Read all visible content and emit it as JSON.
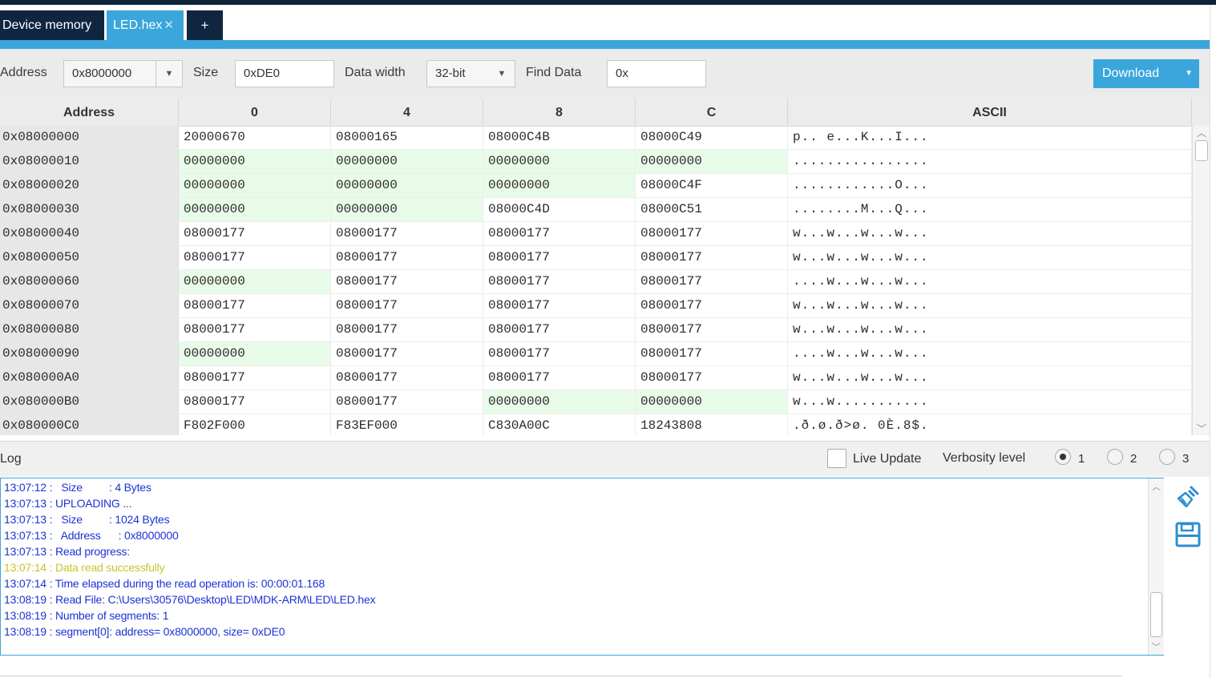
{
  "tabs": [
    {
      "label": "Device memory"
    },
    {
      "label": "LED.hex",
      "close": "✕"
    },
    {
      "label": "+"
    }
  ],
  "toolbar": {
    "address_label": "Address",
    "address_value": "0x8000000",
    "size_label": "Size",
    "size_value": "0xDE0",
    "data_width_label": "Data width",
    "data_width_value": "32-bit",
    "find_label": "Find Data",
    "find_value": "0x",
    "download_label": "Download"
  },
  "grid": {
    "headers": [
      "Address",
      "0",
      "4",
      "8",
      "C",
      "ASCII"
    ],
    "rows": [
      {
        "addr": "0x08000000",
        "c0": "20000670",
        "c4": "08000165",
        "c8": "08000C4B",
        "cc": "08000C49",
        "ascii": "p.. e...K...I..."
      },
      {
        "addr": "0x08000010",
        "c0": "00000000",
        "c4": "00000000",
        "c8": "00000000",
        "cc": "00000000",
        "ascii": "................"
      },
      {
        "addr": "0x08000020",
        "c0": "00000000",
        "c4": "00000000",
        "c8": "00000000",
        "cc": "08000C4F",
        "ascii": "............O..."
      },
      {
        "addr": "0x08000030",
        "c0": "00000000",
        "c4": "00000000",
        "c8": "08000C4D",
        "cc": "08000C51",
        "ascii": "........M...Q..."
      },
      {
        "addr": "0x08000040",
        "c0": "08000177",
        "c4": "08000177",
        "c8": "08000177",
        "cc": "08000177",
        "ascii": "w...w...w...w..."
      },
      {
        "addr": "0x08000050",
        "c0": "08000177",
        "c4": "08000177",
        "c8": "08000177",
        "cc": "08000177",
        "ascii": "w...w...w...w..."
      },
      {
        "addr": "0x08000060",
        "c0": "00000000",
        "c4": "08000177",
        "c8": "08000177",
        "cc": "08000177",
        "ascii": "....w...w...w..."
      },
      {
        "addr": "0x08000070",
        "c0": "08000177",
        "c4": "08000177",
        "c8": "08000177",
        "cc": "08000177",
        "ascii": "w...w...w...w..."
      },
      {
        "addr": "0x08000080",
        "c0": "08000177",
        "c4": "08000177",
        "c8": "08000177",
        "cc": "08000177",
        "ascii": "w...w...w...w..."
      },
      {
        "addr": "0x08000090",
        "c0": "00000000",
        "c4": "08000177",
        "c8": "08000177",
        "cc": "08000177",
        "ascii": "....w...w...w..."
      },
      {
        "addr": "0x080000A0",
        "c0": "08000177",
        "c4": "08000177",
        "c8": "08000177",
        "cc": "08000177",
        "ascii": "w...w...w...w..."
      },
      {
        "addr": "0x080000B0",
        "c0": "08000177",
        "c4": "08000177",
        "c8": "00000000",
        "cc": "00000000",
        "ascii": "w...w..........."
      },
      {
        "addr": "0x080000C0",
        "c0": "F802F000",
        "c4": "F83EF000",
        "c8": "C830A00C",
        "cc": "18243808",
        "ascii": ".ð.ø.ð>ø. 0È.8$."
      }
    ]
  },
  "log": {
    "title": "Log",
    "live_update_label": "Live Update",
    "verbosity_label": "Verbosity level",
    "verbosity_options": [
      "1",
      "2",
      "3"
    ],
    "lines": [
      "13:07:12 :   Size         : 4 Bytes",
      "13:07:13 : UPLOADING ...",
      "13:07:13 :   Size         : 1024 Bytes",
      "13:07:13 :   Address      : 0x8000000",
      "13:07:13 : Read progress:",
      "13:07:14 : Data read successfully",
      "13:07:14 : Time elapsed during the read operation is: 00:00:01.168",
      "13:08:19 : Read File: C:\\Users\\30576\\Desktop\\LED\\MDK-ARM\\LED\\LED.hex",
      "13:08:19 : Number of segments: 1",
      "13:08:19 : segment[0]: address= 0x8000000, size= 0xDE0"
    ]
  },
  "icons": {
    "clear_log": "broom-icon",
    "save_log": "floppy-disk-icon"
  },
  "colors": {
    "accent": "#3aa6dc",
    "tab_dark": "#0f2540",
    "log_text": "#1a33d6",
    "log_success": "#c9c42e",
    "zero_cell": "#e8fbe8"
  }
}
